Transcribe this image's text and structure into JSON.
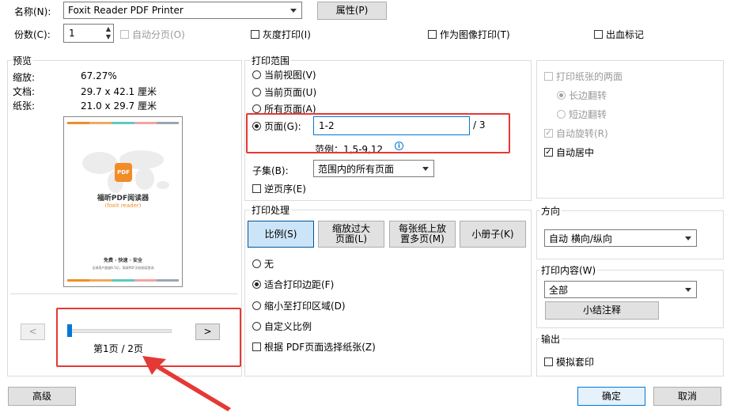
{
  "top": {
    "printer_name_label": "名称(N):",
    "printer_name_value": "Foxit Reader PDF Printer",
    "properties_button": "属性(P)",
    "copies_label": "份数(C):",
    "copies_value": "1",
    "collate_label": "自动分页(O)",
    "grayscale_label": "灰度打印(I)",
    "print_as_image_label": "作为图像打印(T)",
    "bleed_marks_label": "出血标记"
  },
  "preview": {
    "title": "预览",
    "zoom_label": "缩放:",
    "zoom_value": "67.27%",
    "document_label": "文档:",
    "document_value": "29.7 x 42.1 厘米",
    "paper_label": "纸张:",
    "paper_value": "21.0 x 29.7 厘米",
    "thumb_product": "福昕PDF阅读器",
    "thumb_sub": "(foxit reader)",
    "thumb_logo": "PDF",
    "thumb_tagline": "免费 · 快速 · 安全",
    "thumb_desc": "全球用户超越6.5亿，高效PDF文档阅读首选",
    "prev_button": "<",
    "next_button": ">",
    "page_indicator": "第1页 / 2页",
    "slider_position": 0.0
  },
  "print_range": {
    "title": "打印范围",
    "current_view": "当前视图(V)",
    "current_page": "当前页面(U)",
    "all_pages": "所有页面(A)",
    "pages_label": "页面(G):",
    "pages_value": "1-2",
    "pages_total": "/ 3",
    "example": "范例：1,5-9,12",
    "info_icon": "i",
    "subset_label": "子集(B):",
    "subset_value": "范围内的所有页面",
    "reverse_label": "逆页序(E)"
  },
  "print_handling": {
    "title": "打印处理",
    "tab_scale": "比例(S)",
    "tab_fit": "缩放过大\n页面(L)",
    "tab_multiple": "每张纸上放\n置多页(M)",
    "tab_booklet": "小册子(K)",
    "opt_none": "无",
    "opt_fit_margins": "适合打印边距(F)",
    "opt_shrink": "缩小至打印区域(D)",
    "opt_custom": "自定义比例",
    "choose_paper": "根据 PDF页面选择纸张(Z)"
  },
  "duplex": {
    "title": "打印纸张的两面",
    "long_edge": "长边翻转",
    "short_edge": "短边翻转",
    "auto_rotate": "自动旋转(R)",
    "auto_center": "自动居中"
  },
  "orientation": {
    "title": "方向",
    "value": "自动 横向/纵向"
  },
  "print_content": {
    "title": "打印内容(W)",
    "value": "全部",
    "summarize_button": "小结注释"
  },
  "output": {
    "title": "输出",
    "simulate_overprint": "模拟套印"
  },
  "footer": {
    "advanced_button": "高级",
    "ok_button": "确定",
    "cancel_button": "取消"
  },
  "colors": {
    "accent": "#0078d7",
    "highlight_red": "#e53935",
    "foxit_orange": "#f28c28"
  }
}
